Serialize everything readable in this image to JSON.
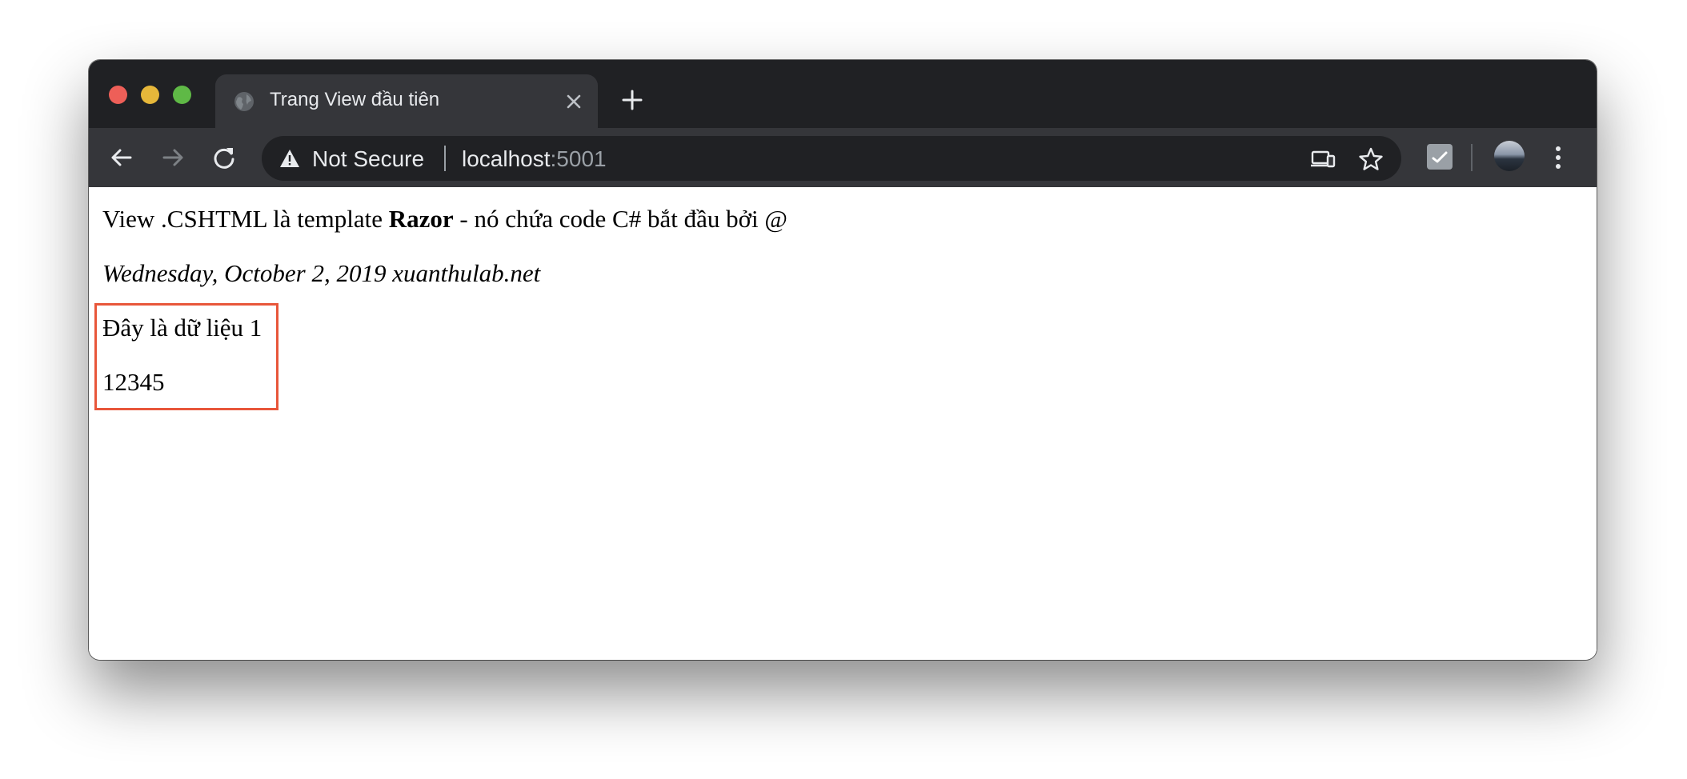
{
  "browser": {
    "tab": {
      "title": "Trang View đầu tiên"
    },
    "omnibox": {
      "security_label": "Not Secure",
      "url_host": "localhost",
      "url_port": ":5001"
    },
    "icons": {
      "back": "back-arrow-icon",
      "forward": "forward-arrow-icon",
      "reload": "reload-icon",
      "warning": "warning-icon",
      "cast": "cast-icon",
      "bookmark": "star-icon",
      "extension": "extension-icon",
      "menu": "more-vertical-icon"
    }
  },
  "page": {
    "line1": {
      "before": "View .CSHTML là template ",
      "bold": "Razor",
      "after": " - nó chứa code C# bắt đầu bởi @"
    },
    "line2": "Wednesday, October 2, 2019 xuanthulab.net",
    "boxed_lines": [
      "Đây là dữ liệu 1",
      "12345"
    ]
  },
  "colors": {
    "tabstrip_bg": "#202124",
    "toolbar_bg": "#35363a",
    "highlight_border": "#e8563a"
  }
}
